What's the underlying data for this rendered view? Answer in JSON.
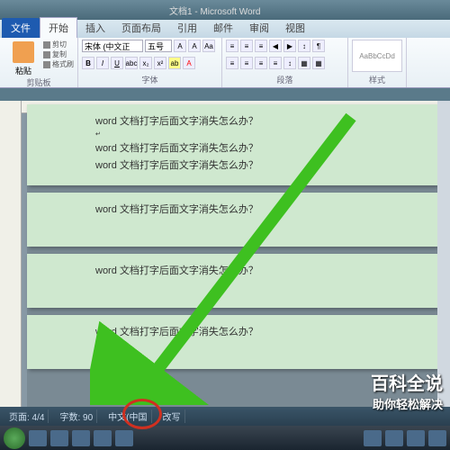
{
  "titlebar": {
    "title": "文档1 - Microsoft Word"
  },
  "tabs": {
    "file": "文件",
    "home": "开始",
    "insert": "插入",
    "layout": "页面布局",
    "ref": "引用",
    "mail": "邮件",
    "review": "审阅",
    "view": "视图"
  },
  "clipboard": {
    "paste": "粘贴",
    "cut": "剪切",
    "copy": "复制",
    "brush": "格式刷",
    "label": "剪贴板"
  },
  "font": {
    "name": "宋体 (中文正",
    "size": "五号",
    "label": "字体"
  },
  "para": {
    "label": "段落"
  },
  "styles": {
    "preview": "AaBbCcDd",
    "label": "样式"
  },
  "doc": {
    "line": "word 文档打字后面文字消失怎么办？"
  },
  "status": {
    "page": "页面: 4/4",
    "words": "字数: 90",
    "lang": "中文(中国",
    "overtype": "改写"
  },
  "watermark": {
    "l1": "百科全说",
    "l2": "助你轻松解决"
  }
}
